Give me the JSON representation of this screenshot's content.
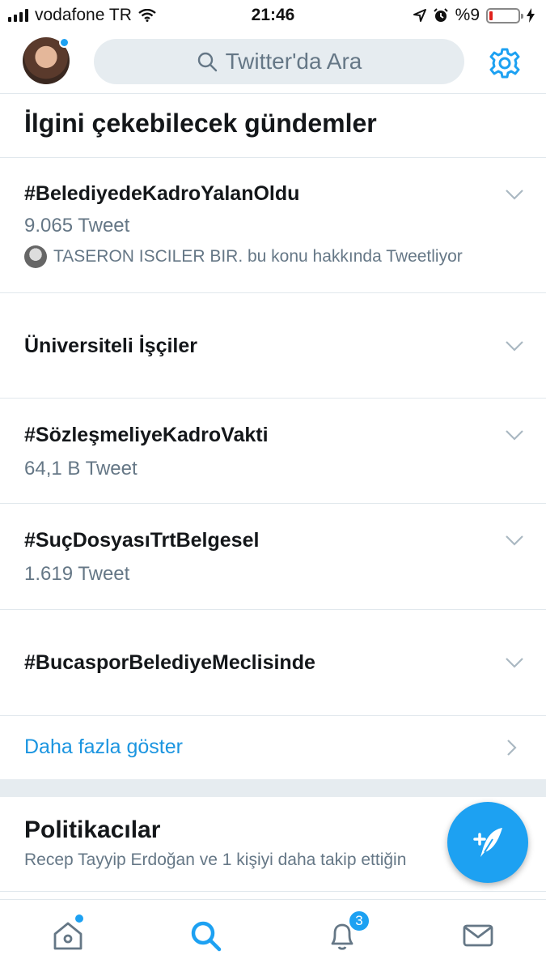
{
  "status_bar": {
    "carrier": "vodafone TR",
    "time": "21:46",
    "battery": "%9",
    "battery_level": 0.09
  },
  "header": {
    "search_placeholder": "Twitter'da Ara"
  },
  "trends": {
    "title": "İlgini çekebilecek gündemler",
    "items": [
      {
        "name": "#BelediyedeKadroYalanOldu",
        "count": "9.065 Tweet",
        "context": "TASERON ISCILER BIR. bu konu hakkında Tweetliyor"
      },
      {
        "name": "Üniversiteli İşçiler"
      },
      {
        "name": "#SözleşmeliyeKadroVakti",
        "count": "64,1 B Tweet"
      },
      {
        "name": "#SuçDosyasıTrtBelgesel",
        "count": "1.619 Tweet"
      },
      {
        "name": "#BucasporBelediyeMeclisinde"
      }
    ],
    "more_label": "Daha fazla göster"
  },
  "politics": {
    "title": "Politikacılar",
    "subtitle": "Recep Tayyip Erdoğan ve 1 kişiyi daha takip ettiğin"
  },
  "tabbar": {
    "notifications_badge": "3"
  },
  "colors": {
    "accent": "#1da1f2",
    "link": "#1b95e0",
    "secondary_text": "#657786",
    "divider": "#e1e8ed"
  },
  "icons": [
    "signal-icon",
    "wifi-icon",
    "location-icon",
    "alarm-icon",
    "battery-icon",
    "charging-icon",
    "search-icon",
    "gear-icon",
    "chevron-down-icon",
    "chevron-right-icon",
    "compose-icon",
    "home-icon",
    "notifications-icon",
    "messages-icon"
  ]
}
